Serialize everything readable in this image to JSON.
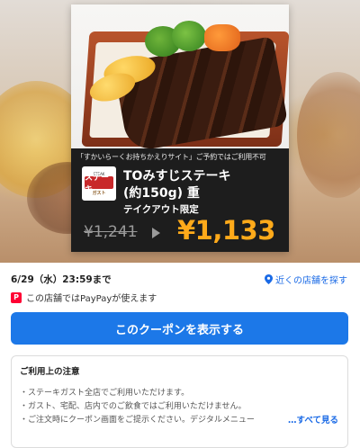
{
  "coupon": {
    "notice": "「すかいらーくお持ちかえりサイト」ご予約ではご利用不可",
    "logo": {
      "top": "STEAK",
      "mid": "ステーキ",
      "bot": "ガスト"
    },
    "title_line1": "TOみすじステーキ",
    "title_line2": "(約150g) 重",
    "subtitle": "テイクアウト限定",
    "old_price": "¥1,241",
    "new_price": "¥1,133"
  },
  "info": {
    "deadline": "6/29（水）23:59まで",
    "nearby_link": "近くの店舗を探す",
    "paypay_text": "この店舗ではPayPayが使えます",
    "paypay_icon": "P"
  },
  "cta": {
    "label": "このクーポンを表示する"
  },
  "notes": {
    "title": "ご利用上の注意",
    "lines": [
      "・ステーキガスト全店でご利用いただけます。",
      "・ガスト、宅配、店内でのご飲食ではご利用いただけません。",
      "・ご注文時にクーポン画面をご提示ください。デジタルメニュー"
    ],
    "more": "…すべて見る"
  },
  "colors": {
    "accent_blue": "#1c78e8",
    "price_orange": "#ffaa1a",
    "paypay_red": "#ff0033"
  }
}
